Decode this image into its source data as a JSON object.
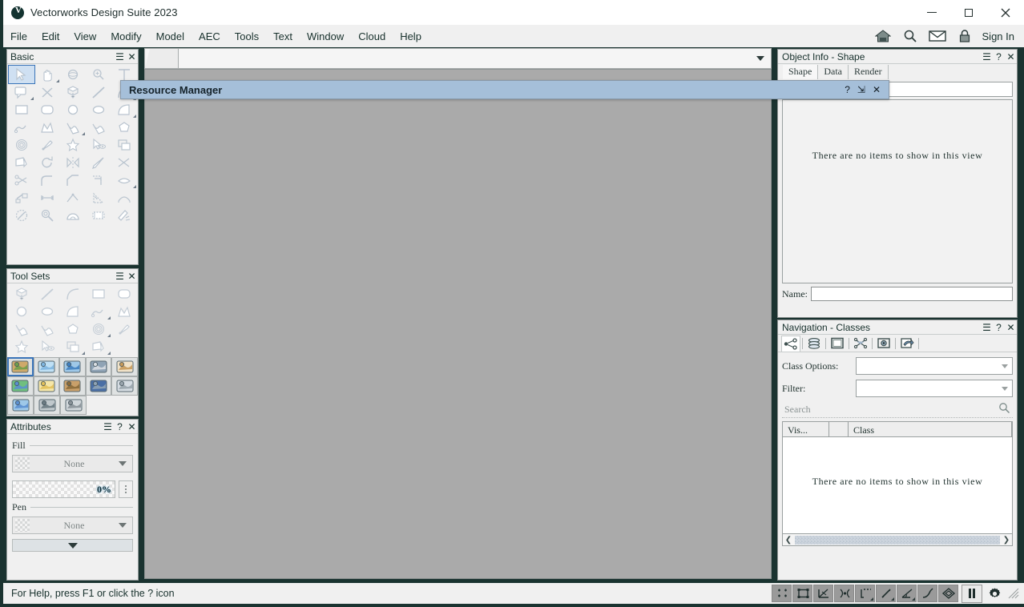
{
  "window": {
    "title": "Vectorworks Design Suite 2023",
    "logo_icon": "vectorworks-logo-icon",
    "minimize_label": "—",
    "maximize_label": "☐",
    "close_label": "✕"
  },
  "menubar": {
    "items": [
      {
        "label": "File"
      },
      {
        "label": "Edit"
      },
      {
        "label": "View"
      },
      {
        "label": "Modify"
      },
      {
        "label": "Model"
      },
      {
        "label": "AEC"
      },
      {
        "label": "Tools"
      },
      {
        "label": "Text"
      },
      {
        "label": "Window"
      },
      {
        "label": "Cloud"
      },
      {
        "label": "Help"
      }
    ],
    "right_icons": [
      {
        "name": "home-icon"
      },
      {
        "name": "search-icon"
      },
      {
        "name": "mail-icon"
      },
      {
        "name": "lock-icon"
      }
    ],
    "sign_in_label": "Sign In"
  },
  "basic_palette": {
    "title": "Basic",
    "menu_label": "☰",
    "close_label": "✕",
    "selected_tool_index": 0,
    "tools": [
      {
        "name": "selection-arrow-tool",
        "has_flyout": false
      },
      {
        "name": "pan-hand-tool",
        "has_flyout": true
      },
      {
        "name": "flyover-tool",
        "has_flyout": false
      },
      {
        "name": "zoom-tool",
        "has_flyout": false
      },
      {
        "name": "text-tool",
        "has_flyout": false
      },
      {
        "name": "callout-tool",
        "has_flyout": true
      },
      {
        "name": "delete-tool",
        "has_flyout": false
      },
      {
        "name": "extrude-tool",
        "has_flyout": false
      },
      {
        "name": "line-tool",
        "has_flyout": false
      },
      {
        "name": "arc-segment-tool",
        "has_flyout": true
      },
      {
        "name": "rectangle-tool",
        "has_flyout": false
      },
      {
        "name": "rounded-rectangle-tool",
        "has_flyout": false
      },
      {
        "name": "circle-tool",
        "has_flyout": false
      },
      {
        "name": "oval-tool",
        "has_flyout": false
      },
      {
        "name": "quarter-arc-tool",
        "has_flyout": true
      },
      {
        "name": "polyline-tool",
        "has_flyout": false
      },
      {
        "name": "polygon-tool",
        "has_flyout": false
      },
      {
        "name": "freehand-tool",
        "has_flyout": true
      },
      {
        "name": "nurbs-curve-tool",
        "has_flyout": false
      },
      {
        "name": "regular-polygon-tool",
        "has_flyout": false
      },
      {
        "name": "spiral-tool",
        "has_flyout": false
      },
      {
        "name": "eyedropper-tool",
        "has_flyout": false
      },
      {
        "name": "magic-wand-tool",
        "has_flyout": false
      },
      {
        "name": "visibility-tool",
        "has_flyout": false
      },
      {
        "name": "duplicate-array-tool",
        "has_flyout": false
      },
      {
        "name": "reshape-tool",
        "has_flyout": false
      },
      {
        "name": "rotate-tool",
        "has_flyout": false
      },
      {
        "name": "mirror-tool",
        "has_flyout": false
      },
      {
        "name": "trim-tool",
        "has_flyout": false
      },
      {
        "name": "split-tool",
        "has_flyout": false
      },
      {
        "name": "scissors-tool",
        "has_flyout": false
      },
      {
        "name": "fillet-tool",
        "has_flyout": false
      },
      {
        "name": "chamfer-tool",
        "has_flyout": false
      },
      {
        "name": "offset-tool",
        "has_flyout": false
      },
      {
        "name": "push-pull-tool",
        "has_flyout": true
      },
      {
        "name": "linear-dimension-tool",
        "has_flyout": false
      },
      {
        "name": "chain-dimension-tool",
        "has_flyout": false
      },
      {
        "name": "baseline-dimension-tool",
        "has_flyout": false
      },
      {
        "name": "angular-dimension-tool",
        "has_flyout": false
      },
      {
        "name": "arc-dimension-tool",
        "has_flyout": false
      },
      {
        "name": "radial-dimension-tool",
        "has_flyout": false
      },
      {
        "name": "selection-similar-tool",
        "has_flyout": false
      },
      {
        "name": "protractor-tool",
        "has_flyout": false
      },
      {
        "name": "tape-measure-tool",
        "has_flyout": false
      },
      {
        "name": "render-bitmap-tool",
        "has_flyout": false
      }
    ]
  },
  "tool_sets": {
    "title": "Tool Sets",
    "menu_label": "☰",
    "close_label": "✕",
    "dim_tools": [
      {
        "name": "site-modifier-tool"
      },
      {
        "name": "hardscape-tool"
      },
      {
        "name": "stipple-tool"
      },
      {
        "name": "roadway-tool"
      },
      {
        "name": "site-pad-tool"
      },
      {
        "name": "bollard-tool"
      },
      {
        "name": "irrigation-tool"
      },
      {
        "name": "earthwork-tool"
      },
      {
        "name": "fence-tool"
      },
      {
        "name": "parking-tool"
      },
      {
        "name": "plant-area-tool"
      },
      {
        "name": "property-line-tool"
      },
      {
        "name": "terrain-tool"
      },
      {
        "name": "site-boundary-tool"
      },
      {
        "name": "parking-space-tool"
      },
      {
        "name": "curb-parking-tool"
      },
      {
        "name": "parking-lot-tool"
      },
      {
        "name": "grade-tool"
      },
      {
        "name": "guardrail-tool"
      }
    ],
    "set_tabs": [
      {
        "name": "site-planning-set",
        "selected": true
      },
      {
        "name": "water-set",
        "selected": false
      },
      {
        "name": "globe-set",
        "selected": false
      },
      {
        "name": "surface-set",
        "selected": false
      },
      {
        "name": "building-set",
        "selected": false
      },
      {
        "name": "shapes-set",
        "selected": false
      },
      {
        "name": "lighting-set",
        "selected": false
      },
      {
        "name": "texture-set",
        "selected": false
      },
      {
        "name": "detailing-set",
        "selected": false
      },
      {
        "name": "structural-set",
        "selected": false
      },
      {
        "name": "plumbing-set",
        "selected": false
      },
      {
        "name": "mechanical-set",
        "selected": false
      },
      {
        "name": "gear-set",
        "selected": false
      }
    ]
  },
  "attributes": {
    "title": "Attributes",
    "menu_label": "☰",
    "help_label": "?",
    "close_label": "✕",
    "fill_group_label": "Fill",
    "fill_value": "None",
    "opacity_value": "0%",
    "pen_group_label": "Pen",
    "pen_value": "None"
  },
  "resource_manager": {
    "title": "Resource Manager",
    "help_label": "?",
    "pin_label": "⇲",
    "close_label": "✕",
    "titlebar_color": "#a5bfd9"
  },
  "object_info": {
    "title": "Object Info - Shape",
    "menu_label": "☰",
    "help_label": "?",
    "close_label": "✕",
    "tabs": [
      {
        "label": "Shape",
        "active": true
      },
      {
        "label": "Data",
        "active": false
      },
      {
        "label": "Render",
        "active": false
      }
    ],
    "empty_message": "There are no items to show in this view",
    "name_label": "Name:",
    "name_value": ""
  },
  "navigation": {
    "title": "Navigation - Classes",
    "menu_label": "☰",
    "help_label": "?",
    "close_label": "✕",
    "tool_icons": [
      {
        "name": "classes-icon",
        "active": true
      },
      {
        "name": "layers-icon",
        "active": false
      },
      {
        "name": "sheet-layers-icon",
        "active": false
      },
      {
        "name": "viewports-icon",
        "active": false
      },
      {
        "name": "saved-views-icon",
        "active": false
      },
      {
        "name": "references-icon",
        "active": false
      }
    ],
    "class_options_label": "Class Options:",
    "class_options_value": "",
    "filter_label": "Filter:",
    "filter_value": "",
    "search_placeholder": "Search",
    "search_icon": "search-icon",
    "columns": [
      {
        "label": "Vis..."
      },
      {
        "label": ""
      },
      {
        "label": "Class"
      }
    ],
    "empty_message": "There are no items to show in this view",
    "scroll_left_label": "❮",
    "scroll_right_label": "❯"
  },
  "view_toolbar": {
    "dropdown_value": "",
    "dropdown_icon": "chevron-down-icon"
  },
  "statusbar": {
    "message": "For Help, press F1 or click the ? icon",
    "snap_buttons": [
      {
        "name": "snap-to-grid-icon",
        "has_flyout": false
      },
      {
        "name": "snap-to-object-icon",
        "has_flyout": false
      },
      {
        "name": "snap-to-intersection-icon",
        "has_flyout": false
      },
      {
        "name": "smart-points-icon",
        "has_flyout": false
      },
      {
        "name": "smart-edge-icon",
        "has_flyout": true
      },
      {
        "name": "snap-to-distance-icon",
        "has_flyout": true
      },
      {
        "name": "snap-to-angle-icon",
        "has_flyout": true
      },
      {
        "name": "snap-to-tangent-icon",
        "has_flyout": false
      },
      {
        "name": "snap-to-surface-icon",
        "has_flyout": false
      }
    ],
    "pause_label": "pause-snapping-icon",
    "gear_label": "snap-settings-gear-icon"
  }
}
